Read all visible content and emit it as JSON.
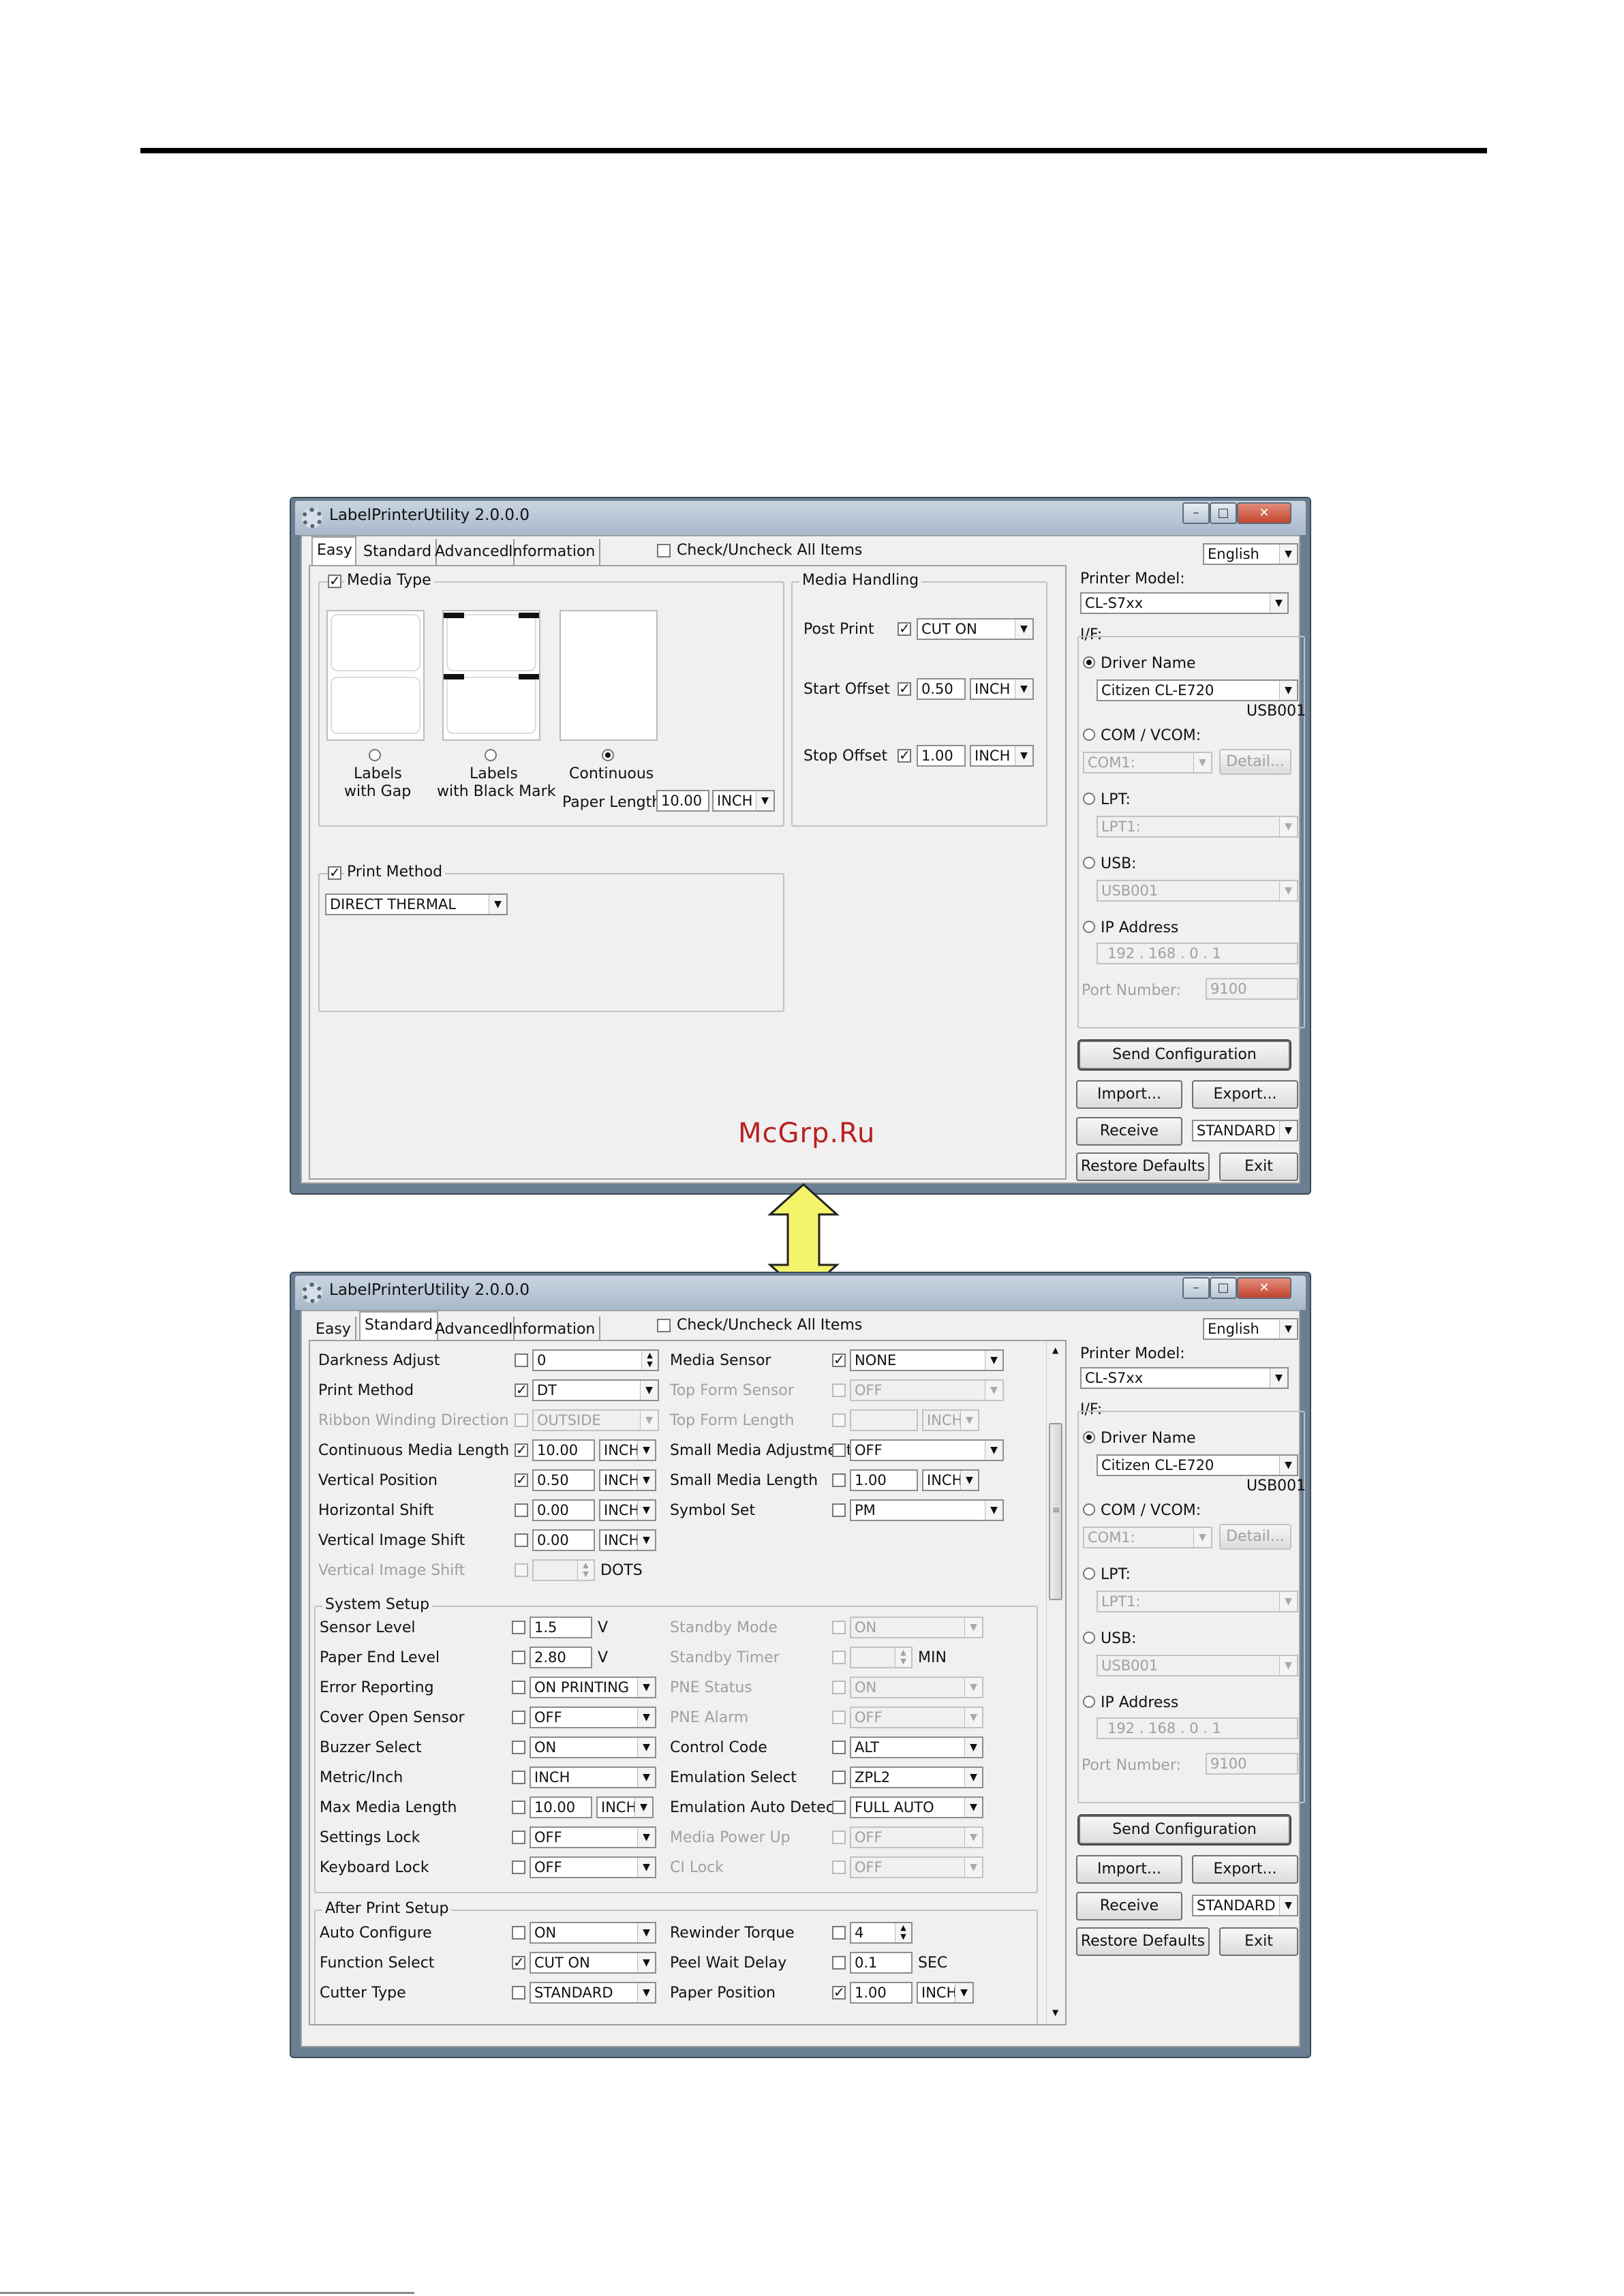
{
  "watermark": "McGrp.Ru",
  "window_top": {
    "title": "LabelPrinterUtility 2.0.0.0",
    "tabs": [
      "Easy",
      "Standard",
      "Advanced",
      "Information"
    ],
    "check_all": "Check/Uncheck All Items",
    "language": "English",
    "media_type": {
      "label": "Media Type",
      "opt_gap": "Labels with Gap",
      "opt_gap_l1": "Labels",
      "opt_gap_l2": "with Gap",
      "opt_bm_l1": "Labels",
      "opt_bm_l2": "with Black Mark",
      "opt_cont": "Continuous",
      "paper_length_label": "Paper Length",
      "paper_length_value": "10.00",
      "paper_length_unit": "INCH"
    },
    "media_handling": {
      "label": "Media Handling",
      "post_print": "Post Print",
      "post_print_value": "CUT ON",
      "start_offset": "Start Offset",
      "start_offset_value": "0.50",
      "start_offset_unit": "INCH",
      "stop_offset": "Stop Offset",
      "stop_offset_value": "1.00",
      "stop_offset_unit": "INCH"
    },
    "print_method": {
      "label": "Print Method",
      "value": "DIRECT THERMAL"
    }
  },
  "side": {
    "printer_model_label": "Printer Model:",
    "printer_model": "CL-S7xx",
    "if_label": "I/F:",
    "driver_name": "Driver Name",
    "driver_value": "Citizen CL-E720",
    "driver_port": "USB001",
    "com_label": "COM / VCOM:",
    "com_value": "COM1:",
    "detail": "Detail...",
    "lpt_label": "LPT:",
    "lpt_value": "LPT1:",
    "usb_label": "USB:",
    "usb_value": "USB001",
    "ip_label": "IP Address",
    "ip_value": "192 . 168 .  0  .  1",
    "port_label": "Port Number:",
    "port_value": "9100",
    "send": "Send Configuration",
    "import": "Import...",
    "export": "Export...",
    "receive": "Receive",
    "standard": "STANDARD",
    "restore": "Restore Defaults",
    "exit": "Exit"
  },
  "window_bottom": {
    "title": "LabelPrinterUtility 2.0.0.0",
    "tabs": [
      "Easy",
      "Standard",
      "Advanced",
      "Information"
    ],
    "check_all": "Check/Uncheck All Items",
    "language": "English",
    "rows_left": [
      {
        "label": "Darkness Adjust",
        "checked": false,
        "value": "0",
        "unit": "",
        "dis": false
      },
      {
        "label": "Print Method",
        "checked": true,
        "value": "DT",
        "unit": "",
        "dis": false
      },
      {
        "label": "Ribbon Winding Direction",
        "checked": false,
        "value": "OUTSIDE",
        "unit": "",
        "dis": true
      },
      {
        "label": "Continuous Media Length",
        "checked": true,
        "value": "10.00",
        "unit": "INCH",
        "dis": false
      },
      {
        "label": "Vertical Position",
        "checked": true,
        "value": "0.50",
        "unit": "INCH",
        "dis": false
      },
      {
        "label": "Horizontal Shift",
        "checked": false,
        "value": "0.00",
        "unit": "INCH",
        "dis": false
      },
      {
        "label": "Vertical Image Shift",
        "checked": false,
        "value": "0.00",
        "unit": "INCH",
        "dis": false
      },
      {
        "label": "Vertical Image Shift",
        "checked": false,
        "value": "",
        "unit": "DOTS",
        "dis": true
      }
    ],
    "rows_right": [
      {
        "label": "Media Sensor",
        "checked": true,
        "value": "NONE",
        "unit": "",
        "dis": false
      },
      {
        "label": "Top Form Sensor",
        "checked": false,
        "value": "OFF",
        "unit": "",
        "dis": true
      },
      {
        "label": "Top Form Length",
        "checked": false,
        "value": "",
        "unit": "INCH",
        "dis": true
      },
      {
        "label": "Small Media Adjustment",
        "checked": false,
        "value": "OFF",
        "unit": "",
        "dis": false
      },
      {
        "label": "Small Media Length",
        "checked": false,
        "value": "1.00",
        "unit": "INCH",
        "dis": false
      },
      {
        "label": "Symbol Set",
        "checked": false,
        "value": "PM",
        "unit": "",
        "dis": false
      }
    ],
    "system_setup": {
      "label": "System Setup",
      "left": [
        {
          "label": "Sensor Level",
          "value": "1.5",
          "unit": "V"
        },
        {
          "label": "Paper End Level",
          "value": "2.80",
          "unit": "V"
        },
        {
          "label": "Error Reporting",
          "value": "ON PRINTING",
          "unit": ""
        },
        {
          "label": "Cover Open Sensor",
          "value": "OFF",
          "unit": ""
        },
        {
          "label": "Buzzer Select",
          "value": "ON",
          "unit": ""
        },
        {
          "label": "Metric/Inch",
          "value": "INCH",
          "unit": ""
        },
        {
          "label": "Max Media Length",
          "value": "10.00",
          "unit": "INCH"
        },
        {
          "label": "Settings Lock",
          "value": "OFF",
          "unit": ""
        },
        {
          "label": "Keyboard Lock",
          "value": "OFF",
          "unit": ""
        }
      ],
      "right": [
        {
          "label": "Standby Mode",
          "value": "ON",
          "unit": "",
          "dis": true
        },
        {
          "label": "Standby Timer",
          "value": "",
          "unit": "MIN",
          "dis": true
        },
        {
          "label": "PNE Status",
          "value": "ON",
          "unit": "",
          "dis": true
        },
        {
          "label": "PNE Alarm",
          "value": "OFF",
          "unit": "",
          "dis": true
        },
        {
          "label": "Control Code",
          "value": "ALT",
          "unit": "",
          "dis": false
        },
        {
          "label": "Emulation Select",
          "value": "ZPL2",
          "unit": "",
          "dis": false
        },
        {
          "label": "Emulation Auto Detect",
          "value": "FULL AUTO",
          "unit": "",
          "dis": false
        },
        {
          "label": "Media Power Up",
          "value": "OFF",
          "unit": "",
          "dis": true
        },
        {
          "label": "CI Lock",
          "value": "OFF",
          "unit": "",
          "dis": true
        }
      ]
    },
    "after_print": {
      "label": "After Print Setup",
      "left": [
        {
          "label": "Auto Configure",
          "checked": false,
          "value": "ON"
        },
        {
          "label": "Function Select",
          "checked": true,
          "value": "CUT ON"
        },
        {
          "label": "Cutter Type",
          "checked": false,
          "value": "STANDARD"
        }
      ],
      "right": [
        {
          "label": "Rewinder Torque",
          "checked": false,
          "value": "4",
          "unit": ""
        },
        {
          "label": "Peel Wait Delay",
          "checked": false,
          "value": "0.1",
          "unit": "SEC"
        },
        {
          "label": "Paper Position",
          "checked": true,
          "value": "1.00",
          "unit": "INCH"
        }
      ]
    }
  },
  "colors": {
    "window_frame": "#6b7f92",
    "client": "#f0f0f0",
    "arrow_fill": "#f4f46a",
    "watermark": "#b82020"
  }
}
